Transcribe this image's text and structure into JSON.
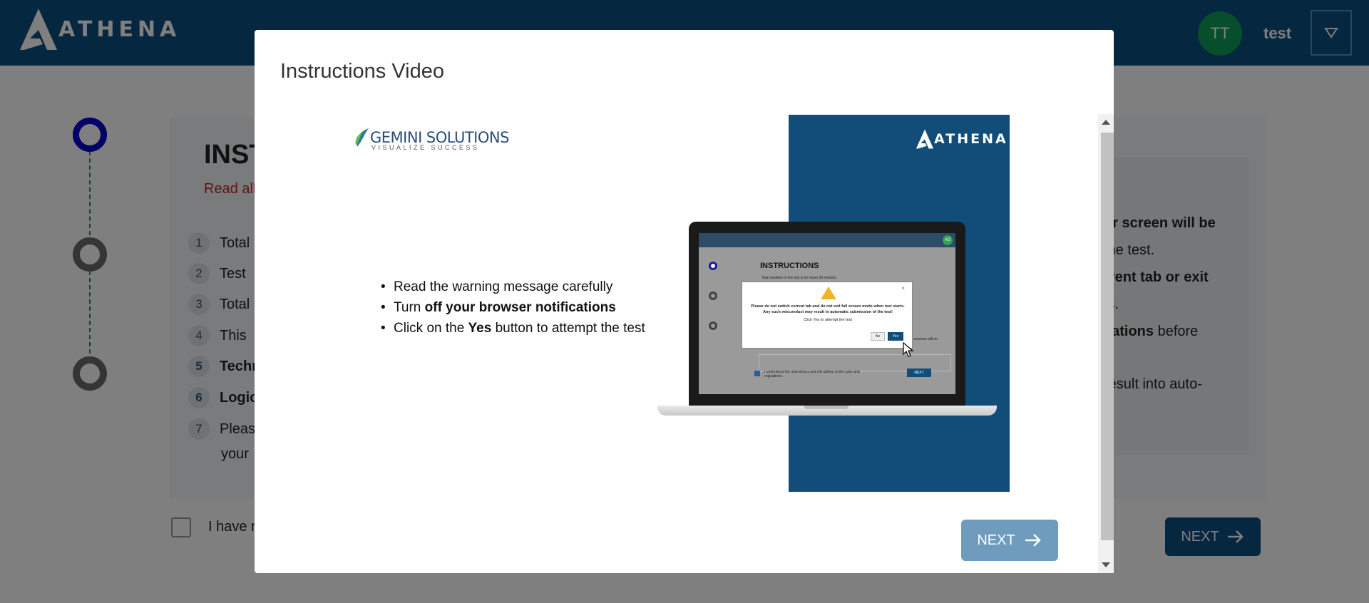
{
  "header": {
    "brand": "ATHENA",
    "avatar_initials": "TT",
    "user_name": "test"
  },
  "background_page": {
    "card_title": "INST",
    "card_subtitle": "Read all",
    "instructions": [
      {
        "num": "1",
        "text": "Total",
        "bold": false
      },
      {
        "num": "2",
        "text": "Test",
        "bold": false
      },
      {
        "num": "3",
        "text": "Total",
        "bold": false
      },
      {
        "num": "4",
        "text": "This",
        "bold": false
      },
      {
        "num": "5",
        "text": "Techn",
        "bold": true
      },
      {
        "num": "6",
        "text": "Logic",
        "bold": true
      },
      {
        "num": "7",
        "text": "Pleas",
        "bold": false
      }
    ],
    "instruction_7_line2": "your",
    "right_panel_lines": [
      {
        "text": "ur screen will be",
        "bold": true
      },
      {
        "text": " the test.",
        "bold": false
      },
      {
        "text": "rrent tab or exit",
        "bold": true
      },
      {
        "text": "ts.",
        "bold": false
      },
      {
        "text": "cations",
        "bold": true,
        "rest": " before"
      },
      {
        "text": "result into auto-",
        "bold": false
      }
    ],
    "checkbox_label": "I have r",
    "next_label": "NEXT"
  },
  "modal": {
    "title": "Instructions Video",
    "next_label": "NEXT",
    "video": {
      "sponsor_name": "GEMINI SOLUTIONS",
      "sponsor_tagline": "VISUALIZE SUCCESS",
      "brand": "ATHENA",
      "bullets": [
        {
          "pre": "Read the warning message carefully",
          "bold": "",
          "post": ""
        },
        {
          "pre": "Turn ",
          "bold": "off your browser notifications",
          "post": ""
        },
        {
          "pre": "Click on the ",
          "bold": "Yes",
          "post": " button to attempt the test"
        }
      ],
      "laptop_screen": {
        "title": "INSTRUCTIONS",
        "line": "Total duration of the test is 01 hours 00 minutes",
        "avatar": "AS",
        "warning_text": "Please do not switch current tab and do not exit full screen mode when test starts. Any such misconduct may result in automatic submission of the test!",
        "warning_sub": "Click Yes to attempt the test",
        "no_label": "No",
        "yes_label": "Yes",
        "field_text": "your answers will no",
        "checkbox_text": "I understood the instructions and will adhere to the rules and regulations.",
        "next_label": "NEXT"
      }
    }
  },
  "colors": {
    "brand_blue": "#0d4f80",
    "modal_next": "#6f9bbc",
    "avatar_green": "#0f9d58",
    "step_active": "#0000cc"
  }
}
